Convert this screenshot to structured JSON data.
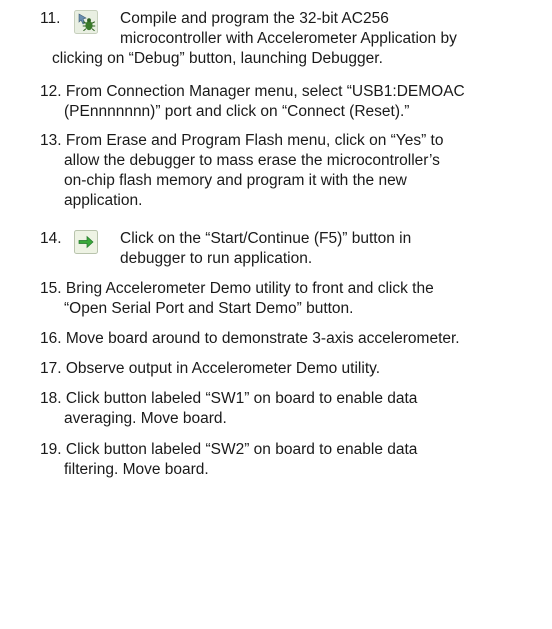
{
  "steps": [
    {
      "number": "11.",
      "icon": "debug-icon",
      "lines": [
        "Compile and program the 32-bit AC256",
        "microcontroller with Accelerometer Application by",
        "clicking on “Debug” button, launching Debugger."
      ]
    },
    {
      "number": "12.",
      "lines": [
        "From Connection Manager menu, select “USB1:DEMOAC",
        "(PEnnnnnnn)” port and click on “Connect (Reset).”"
      ]
    },
    {
      "number": "13.",
      "lines": [
        "From Erase and Program Flash menu, click on “Yes” to",
        "allow the debugger to mass erase the microcontroller’s",
        "on-chip flash memory and program it with the new",
        "application."
      ]
    },
    {
      "number": "14.",
      "icon": "start-continue-icon",
      "lines": [
        "Click on the “Start/Continue (F5)” button in",
        "debugger to run application."
      ]
    },
    {
      "number": "15.",
      "lines": [
        "Bring Accelerometer Demo utility to front and click the",
        "“Open Serial Port and Start Demo” button."
      ]
    },
    {
      "number": "16.",
      "lines": [
        "Move board around to demonstrate 3-axis accelerometer."
      ]
    },
    {
      "number": "17.",
      "lines": [
        "Observe output in Accelerometer Demo utility."
      ]
    },
    {
      "number": "18.",
      "lines": [
        "Click button labeled “SW1” on board to enable data",
        "averaging. Move board."
      ]
    },
    {
      "number": "19.",
      "lines": [
        "Click button labeled “SW2” on board to enable data",
        "filtering. Move board."
      ]
    }
  ],
  "colors": {
    "text": "#1a1a1a",
    "debug_icon_bug": "#3a7a2a",
    "start_icon_arrow": "#3aa83a",
    "start_icon_bg": "#eef3e4"
  }
}
